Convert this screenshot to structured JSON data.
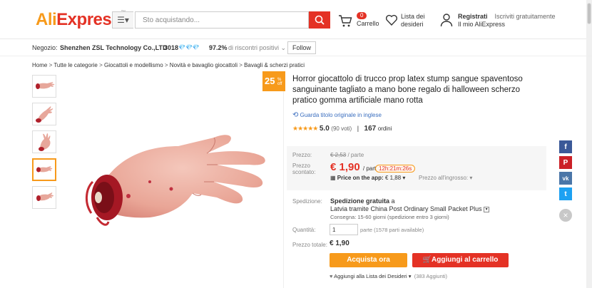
{
  "header": {
    "logo": "AliExpress",
    "search_placeholder": "Sto acquistando...",
    "cart_count": "0",
    "cart_label": "Carrello",
    "wishlist_label": "Lista dei desideri",
    "account_signin": "Registrati",
    "account_join": "Iscriviti gratuitamente",
    "account_my": "Il mio AliExpress"
  },
  "seller": {
    "label": "Negozio:",
    "name": "Shenzhen ZSL Technology Co.,LTD",
    "score": "3018",
    "positive": "97.2%",
    "positive_label": "di riscontri positivi",
    "follow": "Follow"
  },
  "breadcrumb": [
    "Home",
    "Tutte le categorie",
    "Giocattoli e modellismo",
    "Novità e bavaglio giocattoli",
    "Bavagli & scherzi pratici"
  ],
  "product": {
    "discount": "25",
    "discount_suffix": "% off",
    "title": "Horror giocattolo di trucco prop latex stump sangue spaventoso sanguinante tagliato a mano bone regalo di halloween scherzo pratico gomma artificiale mano rotta",
    "translate_label": "Guarda titolo originale in inglese",
    "rating": "5.0",
    "votes": "(90 voti)",
    "orders_count": "167",
    "orders_label": "ordini"
  },
  "pricing": {
    "price_label": "Prezzo:",
    "old_price": "€ 2,53",
    "old_unit": "/ parte",
    "discounted_label": "Prezzo scontato:",
    "current_price": "€ 1,90",
    "current_unit": "/ parte",
    "timer": "12h:21m:26s",
    "app_label": "Price on the app:",
    "app_price": "€ 1,88",
    "wholesale": "Prezzo all'ingrosso:"
  },
  "shipping": {
    "label": "Spedizione:",
    "free": "Spedizione gratuita",
    "to": "a",
    "method": "Latvia tramite China Post Ordinary Small Packet Plus",
    "delivery": "Consegna: 15-60 giorni (spedizione entro 3 giorni)"
  },
  "quantity": {
    "label": "Quantità:",
    "value": "1",
    "available": "parte (1578 parti available)"
  },
  "total": {
    "label": "Prezzo totale:",
    "value": "€ 1,90"
  },
  "actions": {
    "buy_now": "Acquista ora",
    "add_to_cart": "Aggiungi al carrello",
    "add_wishlist": "Aggiungi alla Lista dei Desideri",
    "wishlist_count": "(383 Aggiunti)"
  },
  "social": [
    {
      "icon": "facebook-icon",
      "glyph": "f",
      "color": "#3b5998"
    },
    {
      "icon": "pinterest-icon",
      "glyph": "P",
      "color": "#cb2027"
    },
    {
      "icon": "vk-icon",
      "glyph": "vk",
      "color": "#4a76a8"
    },
    {
      "icon": "twitter-icon",
      "glyph": "t",
      "color": "#1da1f2"
    }
  ],
  "colors": {
    "brand_red": "#e43225",
    "brand_orange": "#f79a1b"
  }
}
